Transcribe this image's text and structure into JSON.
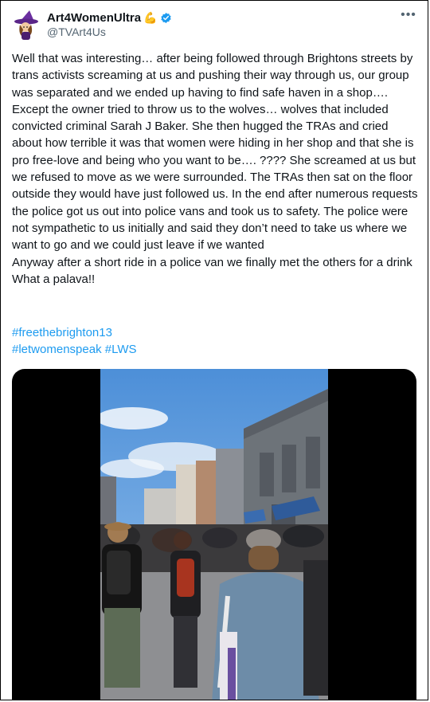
{
  "post": {
    "author_name": "Art4WomenUltra",
    "author_emoji": "💪",
    "handle": "@TVArt4Us",
    "more_label": "•••",
    "body": "Well that was interesting… after being followed through Brightons streets by trans activists screaming at us and pushing their way through us, our group was separated and we ended up having to find safe haven in a shop…. Except the owner tried to throw us to the wolves… wolves that included convicted criminal Sarah J Baker. She then hugged the TRAs and cried about how terrible it was that women were hiding in her shop and that she is pro free-love and being who you want to be…. ???? She screamed at us but we refused to move as we were surrounded. The TRAs then sat on the floor outside they would have just followed us. In the end after numerous requests the police got us out into police vans and took us to safety. The police were not sympathetic to us initially and said they don’t need to take us where we want to go and we could just leave if we wanted\nAnyway after a short ride in a police van we finally met the others for a drink\nWhat a palava!!",
    "hashtags": [
      "#freethebrighton13",
      "#letwomenspeak",
      "#LWS"
    ]
  },
  "colors": {
    "link": "#1d9bf0",
    "verified": "#1d9bf0",
    "muted_text": "#536471"
  }
}
